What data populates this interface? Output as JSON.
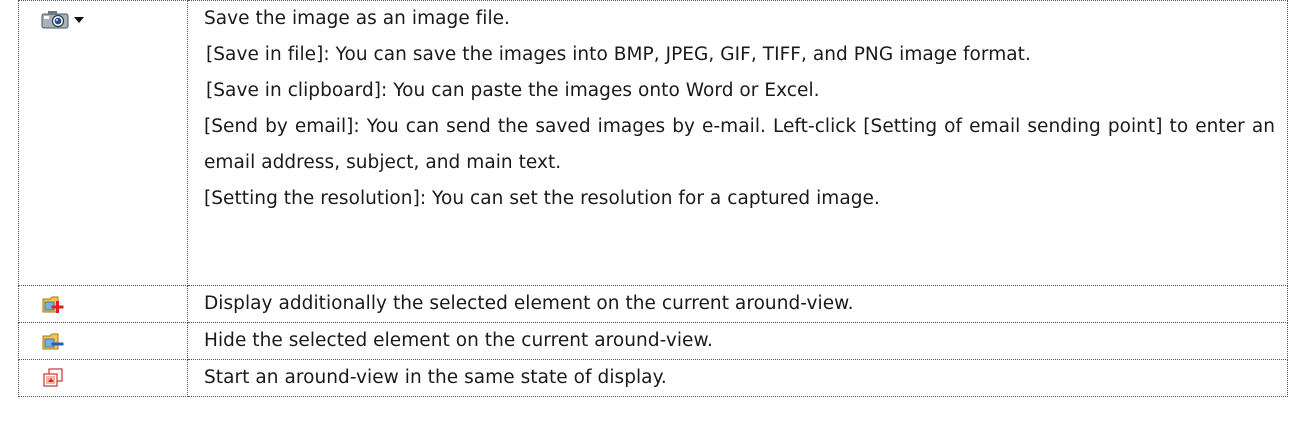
{
  "rows": [
    {
      "icon": "camera-dropdown-icon",
      "lines": [
        "Save the image as an image file.",
        "[Save in file]: You can save the images into BMP, JPEG, GIF, TIFF, and PNG image format.",
        "[Save in clipboard]: You can paste the images onto Word or Excel.",
        "[Send by email]: You can send the saved images by e-mail. Left-click [Setting of email sending point] to enter an email address, subject, and main text.",
        "[Setting the resolution]: You can set the resolution for a captured image."
      ]
    },
    {
      "icon": "add-element-icon",
      "lines": [
        "Display additionally the selected element on the current around-view."
      ]
    },
    {
      "icon": "hide-element-icon",
      "lines": [
        "Hide the selected element on the current around-view."
      ]
    },
    {
      "icon": "start-around-view-icon",
      "lines": [
        "Start an around-view in the same state of display."
      ]
    }
  ]
}
